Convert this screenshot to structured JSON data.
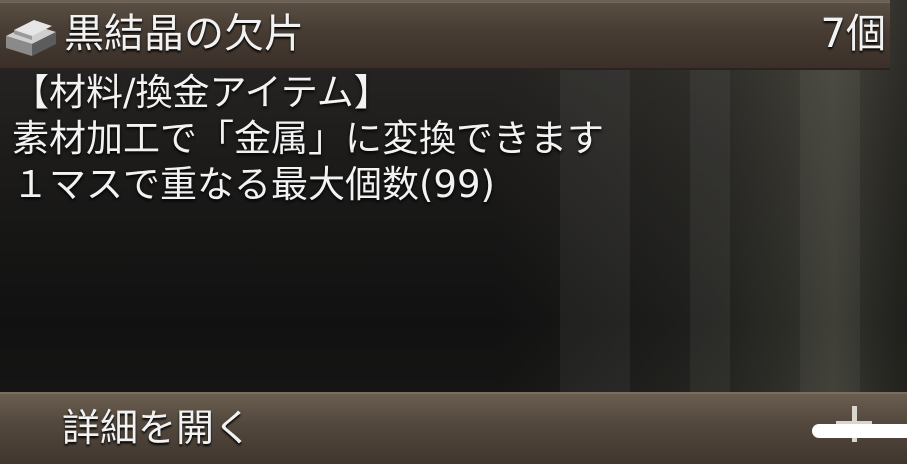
{
  "item": {
    "icon": "metal-ingot-icon",
    "name": "黒結晶の欠片",
    "count": "7個"
  },
  "description": {
    "lines": [
      "【材料/換金アイテム】",
      "素材加工で「金属」に変換できます",
      "１マスで重なる最大個数(99)"
    ]
  },
  "footer": {
    "label": "詳細を開く",
    "expand_icon": "plus-icon"
  },
  "colors": {
    "header_bg": "#463c33",
    "footer_bg": "#54493e",
    "text": "#f2f2f2"
  }
}
